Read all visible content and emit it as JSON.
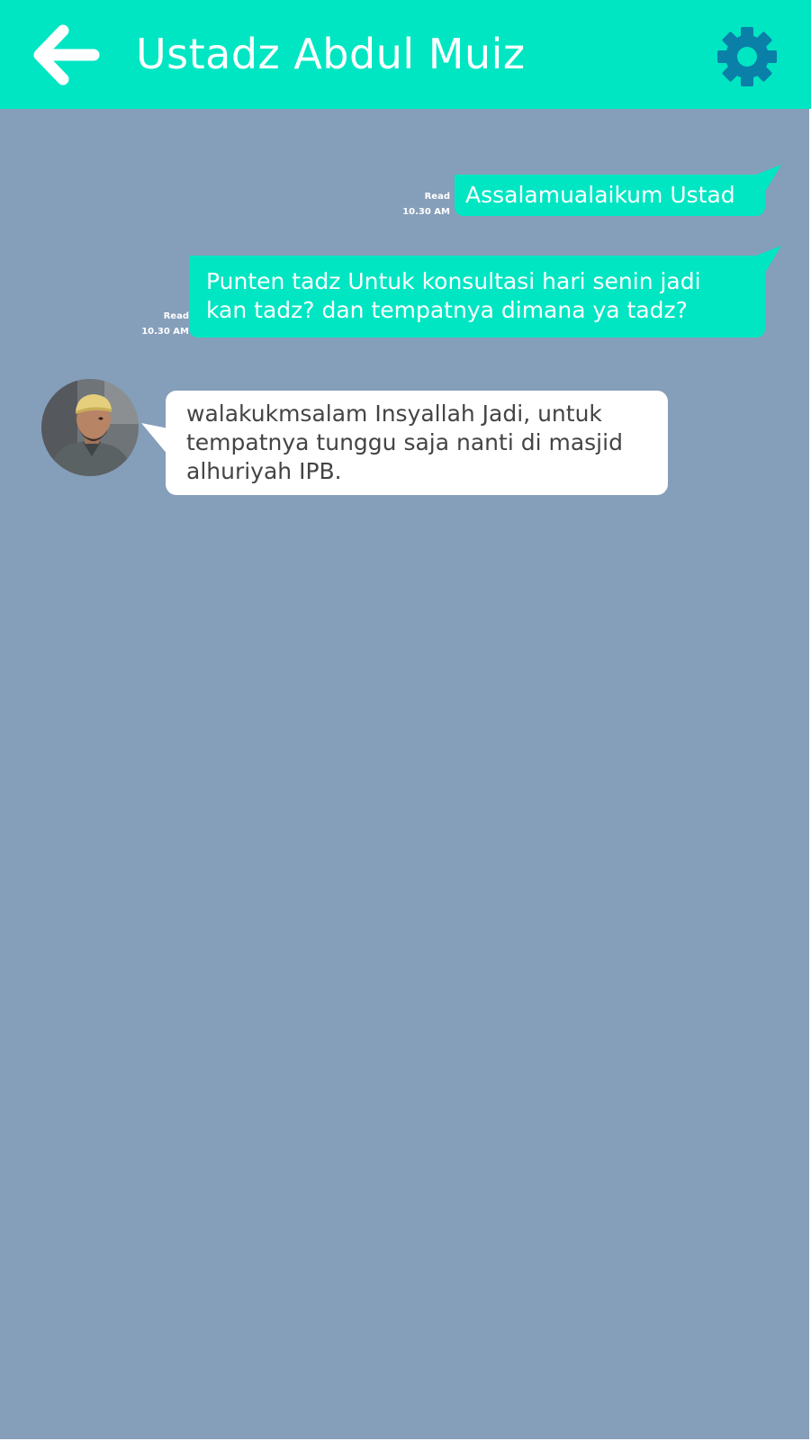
{
  "header": {
    "title": "Ustadz Abdul Muiz",
    "back_icon": "arrow-left-icon",
    "settings_icon": "gear-icon"
  },
  "colors": {
    "header_bg": "#00e6c3",
    "chat_bg": "#859eba",
    "outgoing_bubble": "#00e6c3",
    "incoming_bubble": "#ffffff",
    "gear": "#0a7fa8"
  },
  "messages": [
    {
      "direction": "outgoing",
      "lines": [
        "Assalamualaikum Ustad"
      ],
      "status": "Read",
      "time": "10.30 AM"
    },
    {
      "direction": "outgoing",
      "lines": [
        "Punten tadz Untuk konsultasi hari senin jadi",
        "kan tadz? dan tempatnya dimana ya tadz?"
      ],
      "status": "Read",
      "time": "10.30 AM"
    },
    {
      "direction": "incoming",
      "lines": [
        "walakukmsalam Insyallah Jadi, untuk",
        "tempatnya tunggu saja nanti di masjid",
        "alhuriyah IPB."
      ]
    }
  ]
}
